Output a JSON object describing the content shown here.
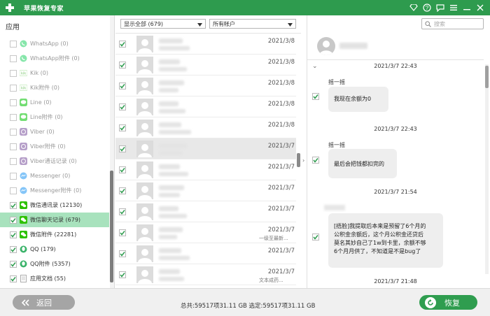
{
  "window": {
    "title": "苹果恢复专家"
  },
  "titlebar_icons": [
    "diamond-icon",
    "help-icon",
    "chat-icon",
    "menu-icon",
    "minimize-icon",
    "close-icon"
  ],
  "sidebar": {
    "header": "应用",
    "items": [
      {
        "label": "WhatsApp (0)",
        "icon": "whatsapp-icon",
        "checked": false
      },
      {
        "label": "WhatsApp附件 (0)",
        "icon": "whatsapp-icon",
        "checked": false
      },
      {
        "label": "Kik (0)",
        "icon": "kik-icon",
        "checked": false
      },
      {
        "label": "Kik附件 (0)",
        "icon": "kik-icon",
        "checked": false
      },
      {
        "label": "Line (0)",
        "icon": "line-icon",
        "checked": false
      },
      {
        "label": "Line附件 (0)",
        "icon": "line-icon",
        "checked": false
      },
      {
        "label": "Viber (0)",
        "icon": "viber-icon",
        "checked": false
      },
      {
        "label": "Viber附件 (0)",
        "icon": "viber-icon",
        "checked": false
      },
      {
        "label": "Viber通话记录 (0)",
        "icon": "viber-icon",
        "checked": false
      },
      {
        "label": "Messenger (0)",
        "icon": "messenger-icon",
        "checked": false
      },
      {
        "label": "Messenger附件 (0)",
        "icon": "messenger-icon",
        "checked": false
      },
      {
        "label": "微信通讯录 (12130)",
        "icon": "wechat-icon",
        "checked": true
      },
      {
        "label": "微信聊天记录 (679)",
        "icon": "wechat-icon",
        "checked": true,
        "selected": true
      },
      {
        "label": "微信附件 (22281)",
        "icon": "wechat-icon",
        "checked": true
      },
      {
        "label": "QQ (179)",
        "icon": "qq-icon",
        "checked": true
      },
      {
        "label": "QQ附件 (5357)",
        "icon": "qq-icon",
        "checked": true
      },
      {
        "label": "应用文档 (55)",
        "icon": "document-icon",
        "checked": true
      }
    ]
  },
  "middle": {
    "filter_label": "显示全部 (679)",
    "account_label": "所有帐户",
    "rows": [
      {
        "date": "2021/3/8",
        "snippet": ""
      },
      {
        "date": "2021/3/8",
        "snippet": ""
      },
      {
        "date": "2021/3/8",
        "snippet": ""
      },
      {
        "date": "2021/3/8",
        "snippet": ""
      },
      {
        "date": "2021/3/8",
        "snippet": ""
      },
      {
        "date": "2021/3/7",
        "snippet": ""
      },
      {
        "date": "2021/3/7",
        "snippet": ""
      },
      {
        "date": "2021/3/7",
        "snippet": ""
      },
      {
        "date": "2021/3/7",
        "snippet": ""
      },
      {
        "date": "2021/3/7",
        "snippet": "一级至最新..."
      },
      {
        "date": "2021/3/7",
        "snippet": ""
      },
      {
        "date": "2021/3/7",
        "snippet": "文本成药..."
      }
    ]
  },
  "right": {
    "search_placeholder": "搜索",
    "messages": [
      {
        "time": "2021/3/7 22:43",
        "sender": "摇一摇",
        "text": [
          "我现在余额为0"
        ]
      },
      {
        "time": "2021/3/7 22:43",
        "sender": "摇一摇",
        "text": [
          "最后会把钱都扣完的"
        ]
      },
      {
        "time": "2021/3/7 21:54",
        "sender": "",
        "text": [
          "[捂脸]我提取后本来是预留了6个月的",
          "公积金余额后，这个月公积金还贷后",
          "莫名其妙自己了1w到卡里，余额不够",
          "6个月月供了，不知道是不是bug了"
        ]
      },
      {
        "time": "2021/3/7 21:48",
        "sender": "",
        "text": []
      }
    ]
  },
  "bottom": {
    "back_label": "返回",
    "status": "总共:59517项31.11 GB 选定:59517项31.11 GB",
    "recover_label": "恢复"
  },
  "colors": {
    "accent": "#2e9b4e",
    "selected_row": "#a8e2bd",
    "back_button": "#a5a5a5"
  }
}
